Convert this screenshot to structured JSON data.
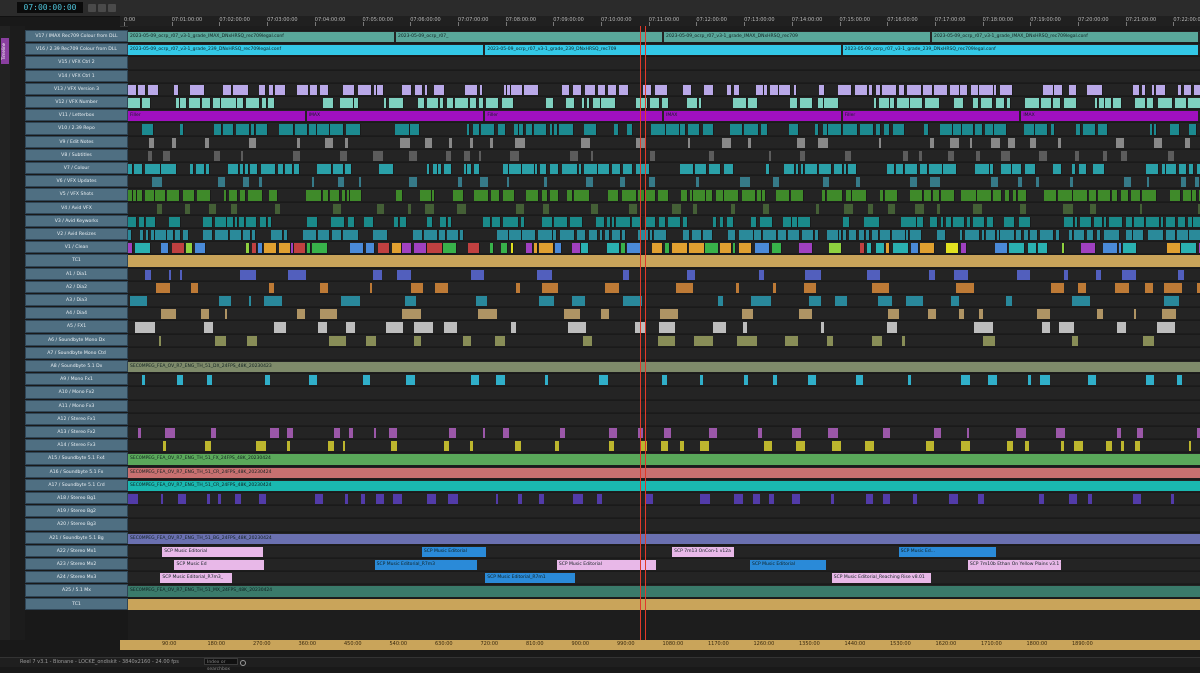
{
  "app": {
    "panel_tab": "Timeline"
  },
  "toolbar": {
    "timecode": "07:00:00:00"
  },
  "ruler": {
    "ticks": [
      "0:00",
      "07:01:00:00",
      "07:02:00:00",
      "07:03:00:00",
      "07:04:00:00",
      "07:05:00:00",
      "07:06:00:00",
      "07:07:00:00",
      "07:08:00:00",
      "07:09:00:00",
      "07:10:00:00",
      "07:11:00:00",
      "07:12:00:00",
      "07:13:00:00",
      "07:14:00:00",
      "07:15:00:00",
      "07:16:00:00",
      "07:17:00:00",
      "07:18:00:00",
      "07:19:00:00",
      "07:20:00:00",
      "07:21:00:00",
      "07:22:00:00"
    ]
  },
  "tracks": [
    {
      "name": "V17 / IMAX Rec709 Colour from DLL",
      "kind": "clip",
      "color": "#59a79a"
    },
    {
      "name": "V16 / 2.39 Rec709 Colour from DLL",
      "kind": "clip",
      "color": "#33c8e6"
    },
    {
      "name": "V15 / VFX Ctrl 2",
      "kind": "empty",
      "color": "#242424"
    },
    {
      "name": "V14 / VFX Ctrl 1",
      "kind": "empty",
      "color": "#242424"
    },
    {
      "name": "V13 / VFX Version 3",
      "kind": "dense",
      "color": "#b9a8e8"
    },
    {
      "name": "V12 / VFX Number",
      "kind": "dense",
      "color": "#7fd0c0"
    },
    {
      "name": "V11 / Letterbox",
      "kind": "clip",
      "color": "#a010c0"
    },
    {
      "name": "V10 / 2.39 Repo",
      "kind": "dense",
      "color": "#1c8a90"
    },
    {
      "name": "V9 / Edit Notes",
      "kind": "sparse",
      "color": "#9a9a9a"
    },
    {
      "name": "V8 / Subtitles",
      "kind": "sparse",
      "color": "#666"
    },
    {
      "name": "V7 / Colour",
      "kind": "dense",
      "color": "#2aa0a8"
    },
    {
      "name": "V6 / VFX Updates",
      "kind": "sparse",
      "color": "#3a8a9a"
    },
    {
      "name": "V5 / VFX Shots",
      "kind": "dense",
      "color": "#3f8a2a"
    },
    {
      "name": "V4 / Avid VFX",
      "kind": "sparse",
      "color": "#4a6a3a"
    },
    {
      "name": "V3 / Avid Keyworks",
      "kind": "dense",
      "color": "#1a8a8a"
    },
    {
      "name": "V2 / Avid Resizes",
      "kind": "dense",
      "color": "#2a8a9a"
    },
    {
      "name": "V1 / Clean",
      "kind": "multi",
      "color": "#e0a030"
    },
    {
      "name": "TC1",
      "kind": "tc",
      "color": "#c9a45a"
    },
    {
      "name": "A1 / Dia1",
      "kind": "audio",
      "color": "#5a6ad8"
    },
    {
      "name": "A2 / Dia2",
      "kind": "audio",
      "color": "#d88a3a"
    },
    {
      "name": "A3 / Dia3",
      "kind": "audio",
      "color": "#2a9ab0"
    },
    {
      "name": "A4 / Dia4",
      "kind": "audio",
      "color": "#c8a870"
    },
    {
      "name": "A5 / FX1",
      "kind": "audio",
      "color": "#d8d8d8"
    },
    {
      "name": "A6 / Soundbyte Mono Dx",
      "kind": "audio",
      "color": "#9aa060"
    },
    {
      "name": "A7 / Soundbyte Mono Ctd",
      "kind": "empty",
      "color": "#242424"
    },
    {
      "name": "A8 / Soundbyte 5.1 Dx",
      "kind": "clip",
      "color": "#7e8a6a"
    },
    {
      "name": "A9 / Mono Fx1",
      "kind": "sparse",
      "color": "#33c8e6"
    },
    {
      "name": "A10 / Mono Fx2",
      "kind": "empty",
      "color": "#242424"
    },
    {
      "name": "A11 / Mono Fx3",
      "kind": "empty",
      "color": "#242424"
    },
    {
      "name": "A12 / Stereo Fx1",
      "kind": "empty",
      "color": "#242424"
    },
    {
      "name": "A13 / Stereo Fx2",
      "kind": "sparse",
      "color": "#b060c0"
    },
    {
      "name": "A14 / Stereo Fx3",
      "kind": "sparse",
      "color": "#d8d030"
    },
    {
      "name": "A15 / Soundbyte 5.1 Fx4",
      "kind": "clip",
      "color": "#5aa85a"
    },
    {
      "name": "A16 / Soundbyte 5.1 Fx",
      "kind": "clip",
      "color": "#c87070"
    },
    {
      "name": "A17 / Soundbyte 5.1 Crd",
      "kind": "clip",
      "color": "#1ab8b0"
    },
    {
      "name": "A18 / Stereo Bg1",
      "kind": "sparse",
      "color": "#5a40c0"
    },
    {
      "name": "A19 / Stereo Bg2",
      "kind": "empty",
      "color": "#242424"
    },
    {
      "name": "A20 / Stereo Bg3",
      "kind": "empty",
      "color": "#242424"
    },
    {
      "name": "A21 / Soundbyte 5.1 Bg",
      "kind": "clip",
      "color": "#6a70b0"
    },
    {
      "name": "A22 / Stereo Mx1",
      "kind": "music",
      "color": "#e8b8e8"
    },
    {
      "name": "A23 / Stereo Mx2",
      "kind": "music",
      "color": "#e8b8e8"
    },
    {
      "name": "A24 / Stereo Mx3",
      "kind": "music",
      "color": "#e8b8e8"
    },
    {
      "name": "A25 / 5.1 Mx",
      "kind": "clip",
      "color": "#3a7a6a"
    },
    {
      "name": "TC1",
      "kind": "tc",
      "color": "#c9a45a"
    }
  ],
  "clips": {
    "v17": [
      "2023-05-09_ocrp_r07_v3-1_grade_IMAX_DNxHRSQ_rec709legal.conf",
      "2023-05-09_ocrp_r07_",
      "2023-05-09_ocrp_r07_v3-1_grade_IMAX_DNxHRSQ_rec709",
      "2023-05-09_ocrp_r07_v3-1_grade_IMAX_DNxHRSQ_rec709legal.conf"
    ],
    "v16": [
      "2023-05-09_ocrp_r07_v3-1_grade_239_DNxHRSQ_rec709legal.conf",
      "2023-05-09_ocrp_r07_v3-1_grade_239_DNxHRSQ_rec709",
      "2023-05-09_ocrp_r07_v3-1_grade_239_DNxHRSQ_rec709legal.conf"
    ],
    "v11": [
      "Filler",
      "IMAX",
      "Filler",
      "IMAX",
      "Filler",
      "IMAX"
    ],
    "a8": "SEC0MPEG_FEA_OV_R7_ENG_TH_51_DX_24FPS_48K_20230423",
    "a15": "SEC0MPEG_FEA_OV_R7_ENG_TH_51_FX_24FPS_48K_20230424",
    "a16": "SEC0MPEG_FEA_OV_R7_ENG_TH_51_CR_24FPS_48K_20230424",
    "a17": "SEC0MPEG_FEA_OV_R7_ENG_TH_51_CR_24FPS_48K_20230424",
    "a21": "SEC0MPEG_FEA_OV_R7_ENG_TH_51_BG_24FPS_48K_20230424",
    "a25": "SEC0MPEG_FEA_OV_R7_ENG_TH_51_MX_24FPS_48K_20230424",
    "a22": [
      "SCP Music Editorial",
      "SCP Music Editorial",
      "SCP 7m13 OnCon-1 v12a",
      "SCP Music Ed..."
    ],
    "a23": [
      "SCP Music Ed",
      "SCP Music Editorial_R7m3",
      "SCP Music Editorial",
      "SCP Music Editorial",
      "SCP 7m10b Ethan On Yellow Plains v3.1 v10.02.07"
    ],
    "a24": [
      "SCP Music Editorial_R7m3_",
      "SCP Music Editorial_R7m1",
      "SCP Music Editorial_Reaching Rise v8.01"
    ]
  },
  "bottom_ruler": {
    "ticks": [
      "90:00",
      "180:00",
      "270:00",
      "360:00",
      "450:00",
      "540:00",
      "630:00",
      "720:00",
      "810:00",
      "900:00",
      "990:00",
      "1080:00",
      "1170:00",
      "1260:00",
      "1350:00",
      "1440:00",
      "1530:00",
      "1620:00",
      "1710:00",
      "1800:00",
      "1890:00"
    ]
  },
  "status": {
    "sequence": "Reel 7 v3.1 - Bionane - LOCKE_ondiskit - 3840x2160 - 24.00 fps",
    "search_placeholder": "Index or searchbox"
  }
}
